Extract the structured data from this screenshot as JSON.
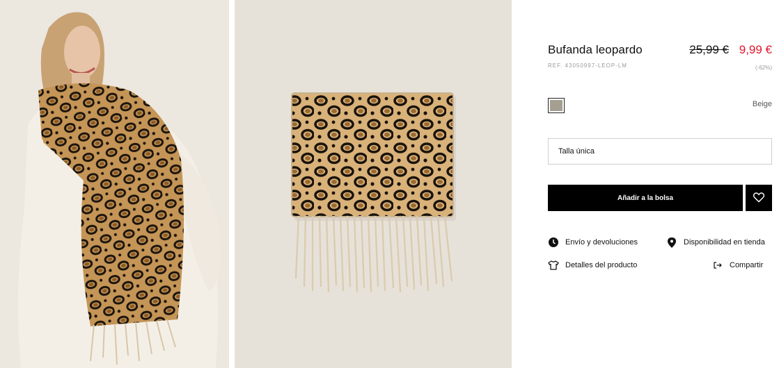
{
  "product": {
    "name": "Bufanda leopardo",
    "ref": "REF. 43050997-LEOP-LM",
    "price_old": "25,99 €",
    "price_new": "9,99 €",
    "discount": "(-62%)",
    "color_name": "Beige",
    "swatch_color": "#a59f92"
  },
  "size": {
    "selected": "Talla única"
  },
  "actions": {
    "add_to_bag": "Añadir a la bolsa"
  },
  "links": {
    "shipping": "Envío y devoluciones",
    "store_availability": "Disponibilidad en tienda",
    "details": "Detalles del producto",
    "share": "Compartir"
  },
  "icons": [
    "clock-icon",
    "location-pin-icon",
    "tshirt-icon",
    "share-icon",
    "heart-icon"
  ],
  "colors": {
    "sale_red": "#e0182d",
    "button_black": "#000000",
    "muted_text": "#9a9a9a"
  }
}
